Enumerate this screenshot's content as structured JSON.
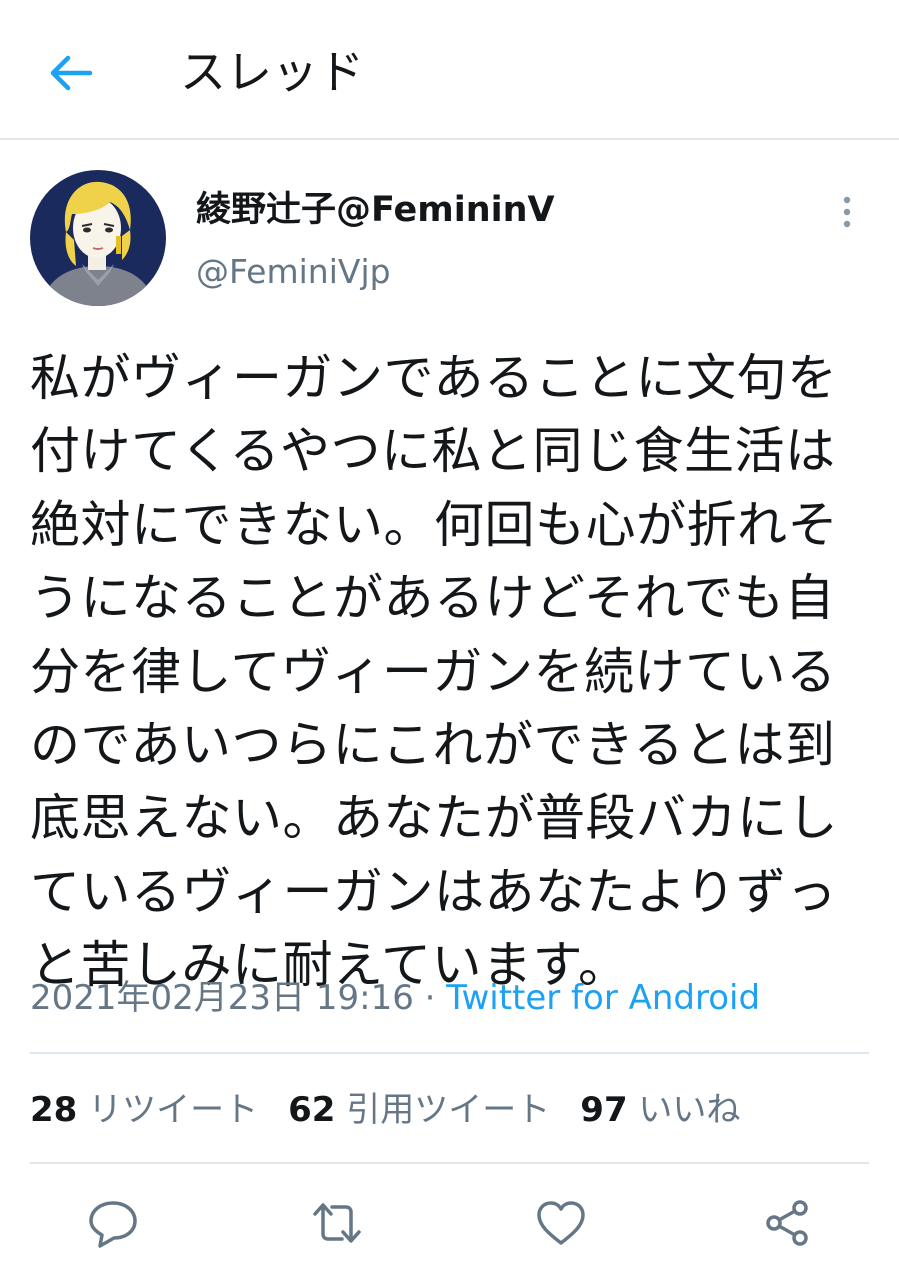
{
  "header": {
    "title": "スレッド",
    "back_icon": "arrow-left-icon"
  },
  "tweet": {
    "display_name": "綾野辻子@FemininV",
    "handle": "@FeminiVjp",
    "text": "私がヴィーガンであることに文句を\n付けてくるやつに私と同じ食生活は\n絶対にできない。何回も心が折れそ\nうになることがあるけどそれでも自\n分を律してヴィーガンを続けている\nのであいつらにこれができるとは到\n底思えない。あなたが普段バカにし\nているヴィーガンはあなたよりずっ\nと苦しみに耐えています。",
    "timestamp": "2021年02月23日 19:16",
    "separator": " · ",
    "source": "Twitter for Android"
  },
  "stats": {
    "retweets": {
      "count": "28",
      "label": "リツイート"
    },
    "quotes": {
      "count": "62",
      "label": "引用ツイート"
    },
    "likes": {
      "count": "97",
      "label": "いいね"
    }
  },
  "colors": {
    "accent": "#1da1f2",
    "secondary_text": "#657786",
    "divider": "#e1e8ed",
    "text": "#14171a"
  },
  "actions": [
    "reply-icon",
    "retweet-icon",
    "like-icon",
    "share-icon"
  ]
}
